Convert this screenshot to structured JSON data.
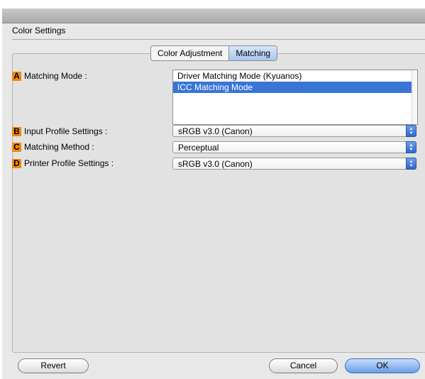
{
  "section": {
    "title": "Color Settings"
  },
  "tabs": [
    {
      "label": "Color Adjustment",
      "selected": false
    },
    {
      "label": "Matching",
      "selected": true
    }
  ],
  "fields": {
    "matching_mode": {
      "badge": "A",
      "label": "Matching Mode :",
      "options": [
        "Driver Matching Mode (Kyuanos)",
        "ICC Matching Mode"
      ],
      "selected": "ICC Matching Mode"
    },
    "input_profile": {
      "badge": "B",
      "label": "Input Profile Settings :",
      "value": "sRGB v3.0 (Canon)"
    },
    "matching_method": {
      "badge": "C",
      "label": "Matching Method :",
      "value": "Perceptual"
    },
    "printer_profile": {
      "badge": "D",
      "label": "Printer Profile Settings :",
      "value": "sRGB v3.0 (Canon)"
    }
  },
  "buttons": {
    "revert": "Revert",
    "cancel": "Cancel",
    "ok": "OK"
  },
  "colors": {
    "badge": "#f08a00",
    "selection": "#3875d7",
    "default_button": "#6a9de6"
  },
  "icons": {
    "popup_arrows": "up-down-arrows-icon"
  }
}
